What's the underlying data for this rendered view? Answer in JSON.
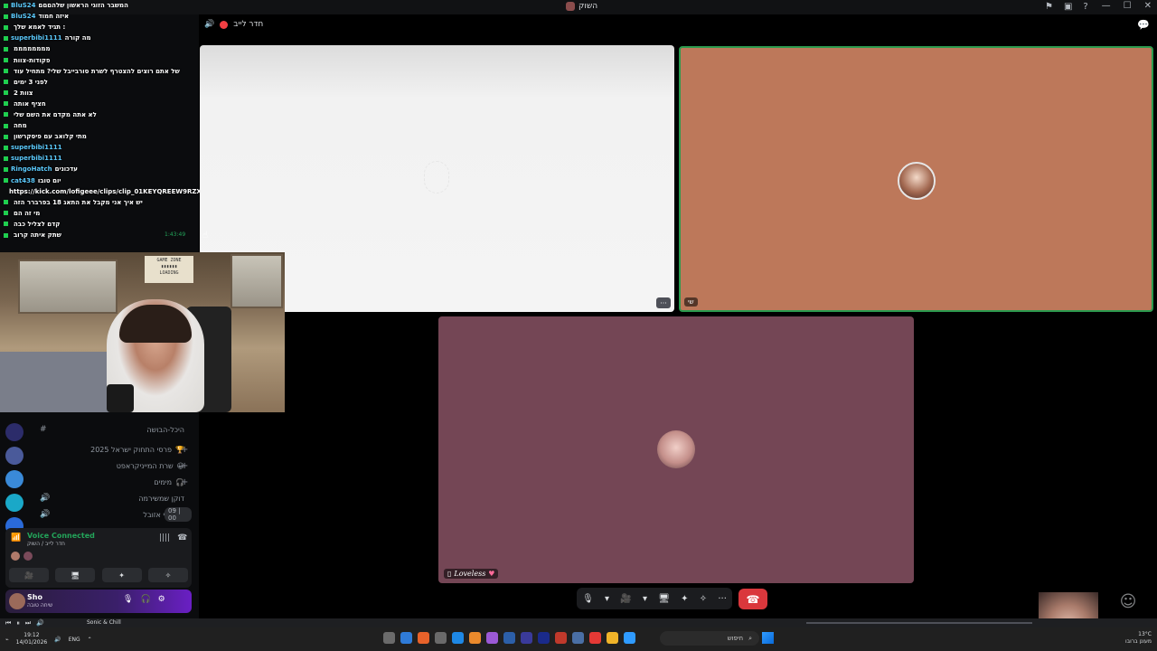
{
  "window": {
    "title": "השוק",
    "buttons": [
      "—",
      "☐",
      "✕"
    ]
  },
  "call": {
    "header_title": "חדר לייב",
    "tiles": [
      {
        "id": "white",
        "label": ""
      },
      {
        "id": "orange",
        "label": "שי"
      },
      {
        "id": "mauve",
        "label": "Loveless"
      }
    ],
    "more_button": "···"
  },
  "chat_overlay": {
    "lines": [
      {
        "user": "BluS24",
        "text": "המשבר הזוגי הראשון שלהםםם"
      },
      {
        "user": "BluS24",
        "text": "איזה חמוד"
      },
      {
        "user": "",
        "text": "תגיד לאמא שלך :"
      },
      {
        "user": "superbibi1111",
        "text": "מה קורה"
      },
      {
        "user": "",
        "text": "ממממממממ"
      },
      {
        "user": "",
        "text": "פקודות-צוות"
      },
      {
        "user": "",
        "text": "של אתם רוצים להצטרף לשרת סורבייבל שלי? מתחיל עוד"
      },
      {
        "user": "",
        "text": "לפני 3 ימים"
      },
      {
        "user": "",
        "text": "צוות 2"
      },
      {
        "user": "",
        "text": "חציף אותה"
      },
      {
        "user": "",
        "text": "לא אתה מקדם את השם שלי"
      },
      {
        "user": "",
        "text": "מחה"
      },
      {
        "user": "",
        "text": "מתי קלואב עם פיסקרשון"
      },
      {
        "user": "superbibi1111",
        "text": ""
      },
      {
        "user": "superbibi1111",
        "text": ""
      },
      {
        "user": "RingoHatch",
        "text": "עדכונים"
      },
      {
        "user": "cat438",
        "text": "יום טובו"
      },
      {
        "user": "",
        "text": "https://kick.com/lofigeee/clips/clip_01KEYQREEW9RZXR4V2ZWGTMZRY"
      },
      {
        "user": "",
        "text": "יש איך אני מקבל את התאג 18 בפרברר הזה"
      },
      {
        "user": "",
        "text": "מי זה הם"
      },
      {
        "user": "",
        "text": "קדם לצליל כבה"
      },
      {
        "user": "",
        "text": "שתק איתה קרוב"
      }
    ],
    "timestamp": "1:43:49"
  },
  "channels": [
    {
      "name": "היכל-הבושה",
      "lead": "#"
    },
    {
      "name": "פרסי התחוק ישראל 2025",
      "lead": "🏆"
    },
    {
      "name": "שרת המייניקראפט",
      "lead": "😀"
    },
    {
      "name": "מימים",
      "lead": "🎧"
    },
    {
      "name": "דוקן שמשירמה",
      "lead": "🔊"
    },
    {
      "name": "ממתקי אזובל",
      "lead": "🔊",
      "count": "09 | 00"
    }
  ],
  "voice_panel": {
    "status": "Voice Connected",
    "location": "חדר לייב / השוק",
    "buttons": [
      "🎥",
      "🖥",
      "✦",
      "✧"
    ]
  },
  "user_panel": {
    "name": "Sho",
    "status": "שיחה טובה",
    "controls": [
      "🎙",
      "🎧",
      "⚙"
    ]
  },
  "call_controls": [
    "🎙",
    "▾",
    "🎥",
    "▾",
    "🖥",
    "✦",
    "✧",
    "···"
  ],
  "hangup_icon": "☎",
  "webcam_poster": "GAME ZONE\n▮▮▮▮▮▮\nLOADING",
  "media": {
    "track": "Sonic & Chill",
    "controls": [
      "⏮",
      "⏸",
      "⏭",
      "🔊"
    ]
  },
  "taskbar": {
    "time": "19:12",
    "date": "14/01/2026",
    "lang": "ENG",
    "search_label": "חיפוש",
    "weather": "13°C",
    "weather_sub": "מעונן ברובו",
    "app_colors": [
      "#6b6b6b",
      "#2f7bd8",
      "#e8622a",
      "#6a6a6a",
      "#1e88e5",
      "#eb8a2c",
      "#9b59d6",
      "#2c5fa8",
      "#3a3a9a",
      "#1a2a8a",
      "#c0392b",
      "#4a6fa5",
      "#e53935",
      "#f0b429",
      "#2f9bff"
    ]
  },
  "colors": {
    "tile_white": "#f4f4f4",
    "tile_orange": "#bd785a",
    "tile_mauve": "#744655",
    "speaking_border": "#2c9a4e",
    "hangup": "#da373c",
    "voice_green": "#23a55a"
  }
}
